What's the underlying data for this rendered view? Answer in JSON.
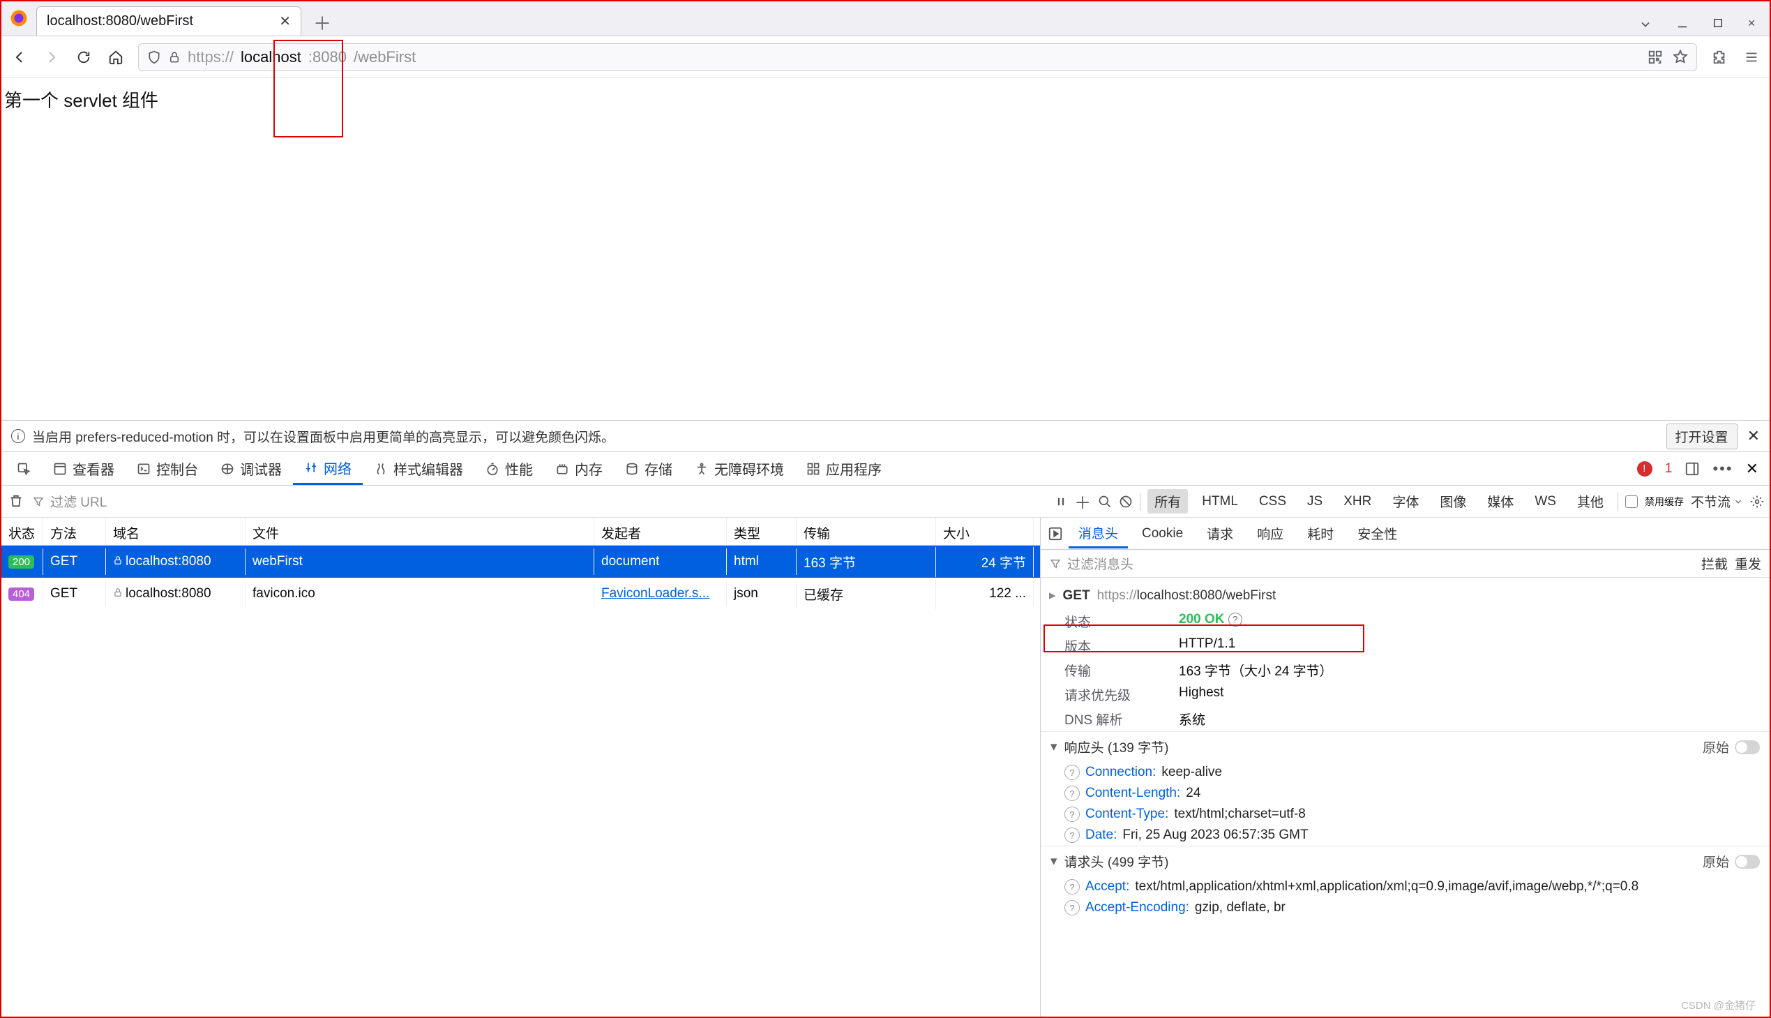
{
  "browser": {
    "tab_title": "localhost:8080/webFirst",
    "url_proto": "https://",
    "url_host": "localhost",
    "url_port": ":8080",
    "url_path": "/webFirst"
  },
  "page": {
    "body_text": "第一个 servlet 组件"
  },
  "devtools": {
    "info_bar": "当启用 prefers-reduced-motion 时，可以在设置面板中启用更简单的高亮显示，可以避免颜色闪烁。",
    "open_settings": "打开设置",
    "tabs": {
      "inspector": "查看器",
      "console": "控制台",
      "debugger": "调试器",
      "network": "网络",
      "style": "样式编辑器",
      "perf": "性能",
      "memory": "内存",
      "storage": "存储",
      "accessibility": "无障碍环境",
      "application": "应用程序"
    },
    "error_count": "1"
  },
  "netbar": {
    "filter_placeholder": "过滤 URL",
    "types": {
      "all": "所有",
      "html": "HTML",
      "css": "CSS",
      "js": "JS",
      "xhr": "XHR",
      "font": "字体",
      "image": "图像",
      "media": "媒体",
      "ws": "WS",
      "other": "其他"
    },
    "disable_cache": "禁用缓存",
    "throttle": "不节流"
  },
  "table": {
    "headers": {
      "status": "状态",
      "method": "方法",
      "domain": "域名",
      "file": "文件",
      "initiator": "发起者",
      "type": "类型",
      "transfer": "传输",
      "size": "大小"
    },
    "rows": [
      {
        "status": "200",
        "status_cls": "s200",
        "method": "GET",
        "domain": "localhost:8080",
        "file": "webFirst",
        "initiator": "document",
        "type": "html",
        "transfer": "163 字节",
        "size": "24 字节",
        "selected": true,
        "lockColor": "#fff"
      },
      {
        "status": "404",
        "status_cls": "s404",
        "method": "GET",
        "domain": "localhost:8080",
        "file": "favicon.ico",
        "initiator": "FaviconLoader.s...",
        "type": "json",
        "transfer": "已缓存",
        "size": "122 ...",
        "selected": false,
        "lockColor": "#8a8a8a"
      }
    ]
  },
  "details": {
    "tabs": {
      "headers": "消息头",
      "cookie": "Cookie",
      "request": "请求",
      "response": "响应",
      "timing": "耗时",
      "security": "安全性"
    },
    "filter_placeholder": "过滤消息头",
    "block": "拦截",
    "resend": "重发",
    "req": {
      "method": "GET",
      "proto": "https://",
      "rest": "localhost:8080/webFirst"
    },
    "summary": {
      "status_k": "状态",
      "status_v": "200 OK",
      "version_k": "版本",
      "version_v": "HTTP/1.1",
      "transfer_k": "传输",
      "transfer_v": "163 字节（大小 24 字节）",
      "priority_k": "请求优先级",
      "priority_v": "Highest",
      "dns_k": "DNS 解析",
      "dns_v": "系统"
    },
    "resp_hdr_title": "响应头 (139 字节)",
    "raw": "原始",
    "resp_headers": [
      {
        "k": "Connection:",
        "v": "keep-alive"
      },
      {
        "k": "Content-Length:",
        "v": "24"
      },
      {
        "k": "Content-Type:",
        "v": "text/html;charset=utf-8"
      },
      {
        "k": "Date:",
        "v": "Fri, 25 Aug 2023 06:57:35 GMT"
      }
    ],
    "req_hdr_title": "请求头 (499 字节)",
    "req_headers": [
      {
        "k": "Accept:",
        "v": "text/html,application/xhtml+xml,application/xml;q=0.9,image/avif,image/webp,*/*;q=0.8"
      },
      {
        "k": "Accept-Encoding:",
        "v": "gzip, deflate, br"
      }
    ]
  },
  "watermark": "CSDN @金猪仔"
}
